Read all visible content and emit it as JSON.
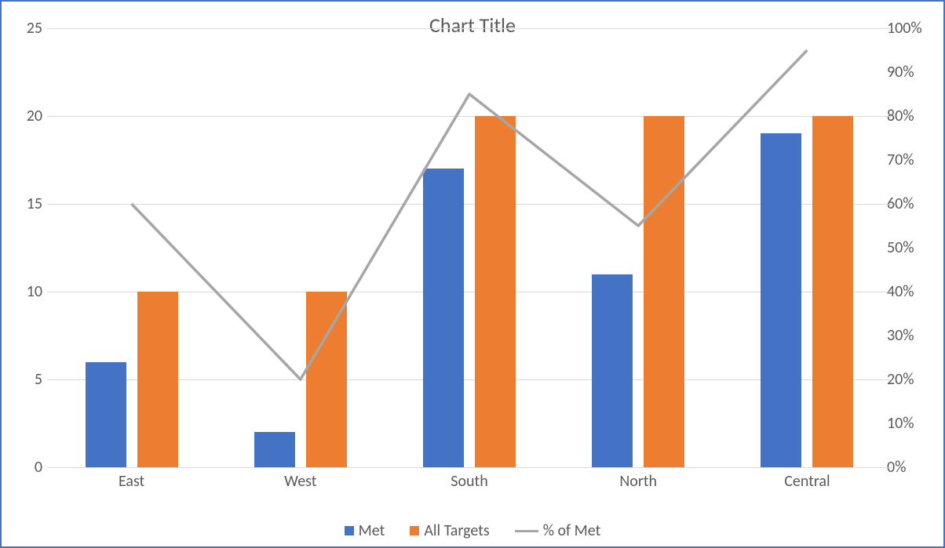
{
  "chart_data": {
    "type": "bar",
    "title": "Chart Title",
    "categories": [
      "East",
      "West",
      "South",
      "North",
      "Central"
    ],
    "series": [
      {
        "name": "Met",
        "type": "bar",
        "axis": "left",
        "values": [
          6,
          2,
          17,
          11,
          19
        ],
        "color": "#4472C4"
      },
      {
        "name": "All Targets",
        "type": "bar",
        "axis": "left",
        "values": [
          10,
          10,
          20,
          20,
          20
        ],
        "color": "#ED7D31"
      },
      {
        "name": "% of Met",
        "type": "line",
        "axis": "right",
        "values": [
          0.6,
          0.2,
          0.85,
          0.55,
          0.95
        ],
        "color": "#A6A6A6"
      }
    ],
    "yaxis_left": {
      "min": 0,
      "max": 25,
      "step": 5,
      "ticks": [
        "0",
        "5",
        "10",
        "15",
        "20",
        "25"
      ]
    },
    "yaxis_right": {
      "min": 0,
      "max": 1.0,
      "step": 0.1,
      "ticks": [
        "0%",
        "10%",
        "20%",
        "30%",
        "40%",
        "50%",
        "60%",
        "70%",
        "80%",
        "90%",
        "100%"
      ]
    },
    "legend": [
      "Met",
      "All Targets",
      "% of Met"
    ]
  }
}
